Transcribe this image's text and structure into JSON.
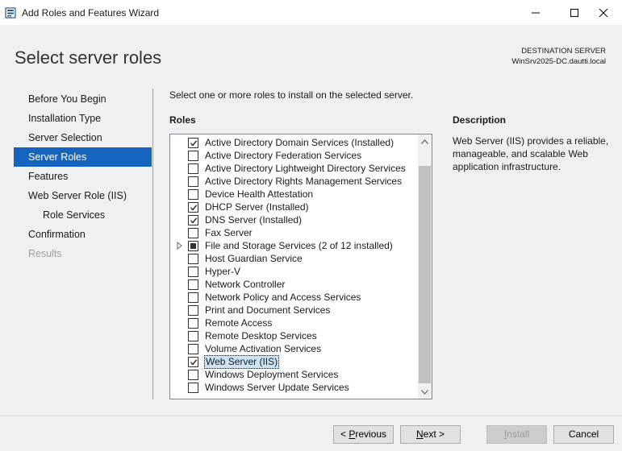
{
  "window": {
    "title": "Add Roles and Features Wizard",
    "icon": "server-manager-icon",
    "controls": [
      "minimize-icon",
      "maximize-icon",
      "close-icon"
    ]
  },
  "header": {
    "page_title": "Select server roles",
    "destination_label": "DESTINATION SERVER",
    "destination_server": "WinSrv2025-DC.dautti.local"
  },
  "steps": [
    {
      "label": "Before You Begin",
      "state": "normal",
      "sub": false
    },
    {
      "label": "Installation Type",
      "state": "normal",
      "sub": false
    },
    {
      "label": "Server Selection",
      "state": "normal",
      "sub": false
    },
    {
      "label": "Server Roles",
      "state": "active",
      "sub": false
    },
    {
      "label": "Features",
      "state": "normal",
      "sub": false
    },
    {
      "label": "Web Server Role (IIS)",
      "state": "normal",
      "sub": false
    },
    {
      "label": "Role Services",
      "state": "normal",
      "sub": true
    },
    {
      "label": "Confirmation",
      "state": "normal",
      "sub": false
    },
    {
      "label": "Results",
      "state": "disabled",
      "sub": false
    }
  ],
  "main": {
    "instruction": "Select one or more roles to install on the selected server.",
    "roles_label": "Roles",
    "roles": [
      {
        "label": "Active Directory Domain Services (Installed)",
        "state": "checked",
        "expandable": false,
        "selected": false
      },
      {
        "label": "Active Directory Federation Services",
        "state": "unchecked",
        "expandable": false,
        "selected": false
      },
      {
        "label": "Active Directory Lightweight Directory Services",
        "state": "unchecked",
        "expandable": false,
        "selected": false
      },
      {
        "label": "Active Directory Rights Management Services",
        "state": "unchecked",
        "expandable": false,
        "selected": false
      },
      {
        "label": "Device Health Attestation",
        "state": "unchecked",
        "expandable": false,
        "selected": false
      },
      {
        "label": "DHCP Server (Installed)",
        "state": "checked",
        "expandable": false,
        "selected": false
      },
      {
        "label": "DNS Server (Installed)",
        "state": "checked",
        "expandable": false,
        "selected": false
      },
      {
        "label": "Fax Server",
        "state": "unchecked",
        "expandable": false,
        "selected": false
      },
      {
        "label": "File and Storage Services (2 of 12 installed)",
        "state": "partial",
        "expandable": true,
        "selected": false
      },
      {
        "label": "Host Guardian Service",
        "state": "unchecked",
        "expandable": false,
        "selected": false
      },
      {
        "label": "Hyper-V",
        "state": "unchecked",
        "expandable": false,
        "selected": false
      },
      {
        "label": "Network Controller",
        "state": "unchecked",
        "expandable": false,
        "selected": false
      },
      {
        "label": "Network Policy and Access Services",
        "state": "unchecked",
        "expandable": false,
        "selected": false
      },
      {
        "label": "Print and Document Services",
        "state": "unchecked",
        "expandable": false,
        "selected": false
      },
      {
        "label": "Remote Access",
        "state": "unchecked",
        "expandable": false,
        "selected": false
      },
      {
        "label": "Remote Desktop Services",
        "state": "unchecked",
        "expandable": false,
        "selected": false
      },
      {
        "label": "Volume Activation Services",
        "state": "unchecked",
        "expandable": false,
        "selected": false
      },
      {
        "label": "Web Server (IIS)",
        "state": "checked",
        "expandable": false,
        "selected": true
      },
      {
        "label": "Windows Deployment Services",
        "state": "unchecked",
        "expandable": false,
        "selected": false
      },
      {
        "label": "Windows Server Update Services",
        "state": "unchecked",
        "expandable": false,
        "selected": false
      }
    ],
    "description_label": "Description",
    "description_text": "Web Server (IIS) provides a reliable, manageable, and scalable Web application infrastructure."
  },
  "footer": {
    "previous": {
      "pre": "< ",
      "mnemonic": "P",
      "rest": "revious"
    },
    "next": {
      "pre": "",
      "mnemonic": "N",
      "rest": "ext >"
    },
    "install": {
      "pre": "",
      "mnemonic": "I",
      "rest": "nstall",
      "disabled": true
    },
    "cancel": {
      "label": "Cancel"
    }
  }
}
